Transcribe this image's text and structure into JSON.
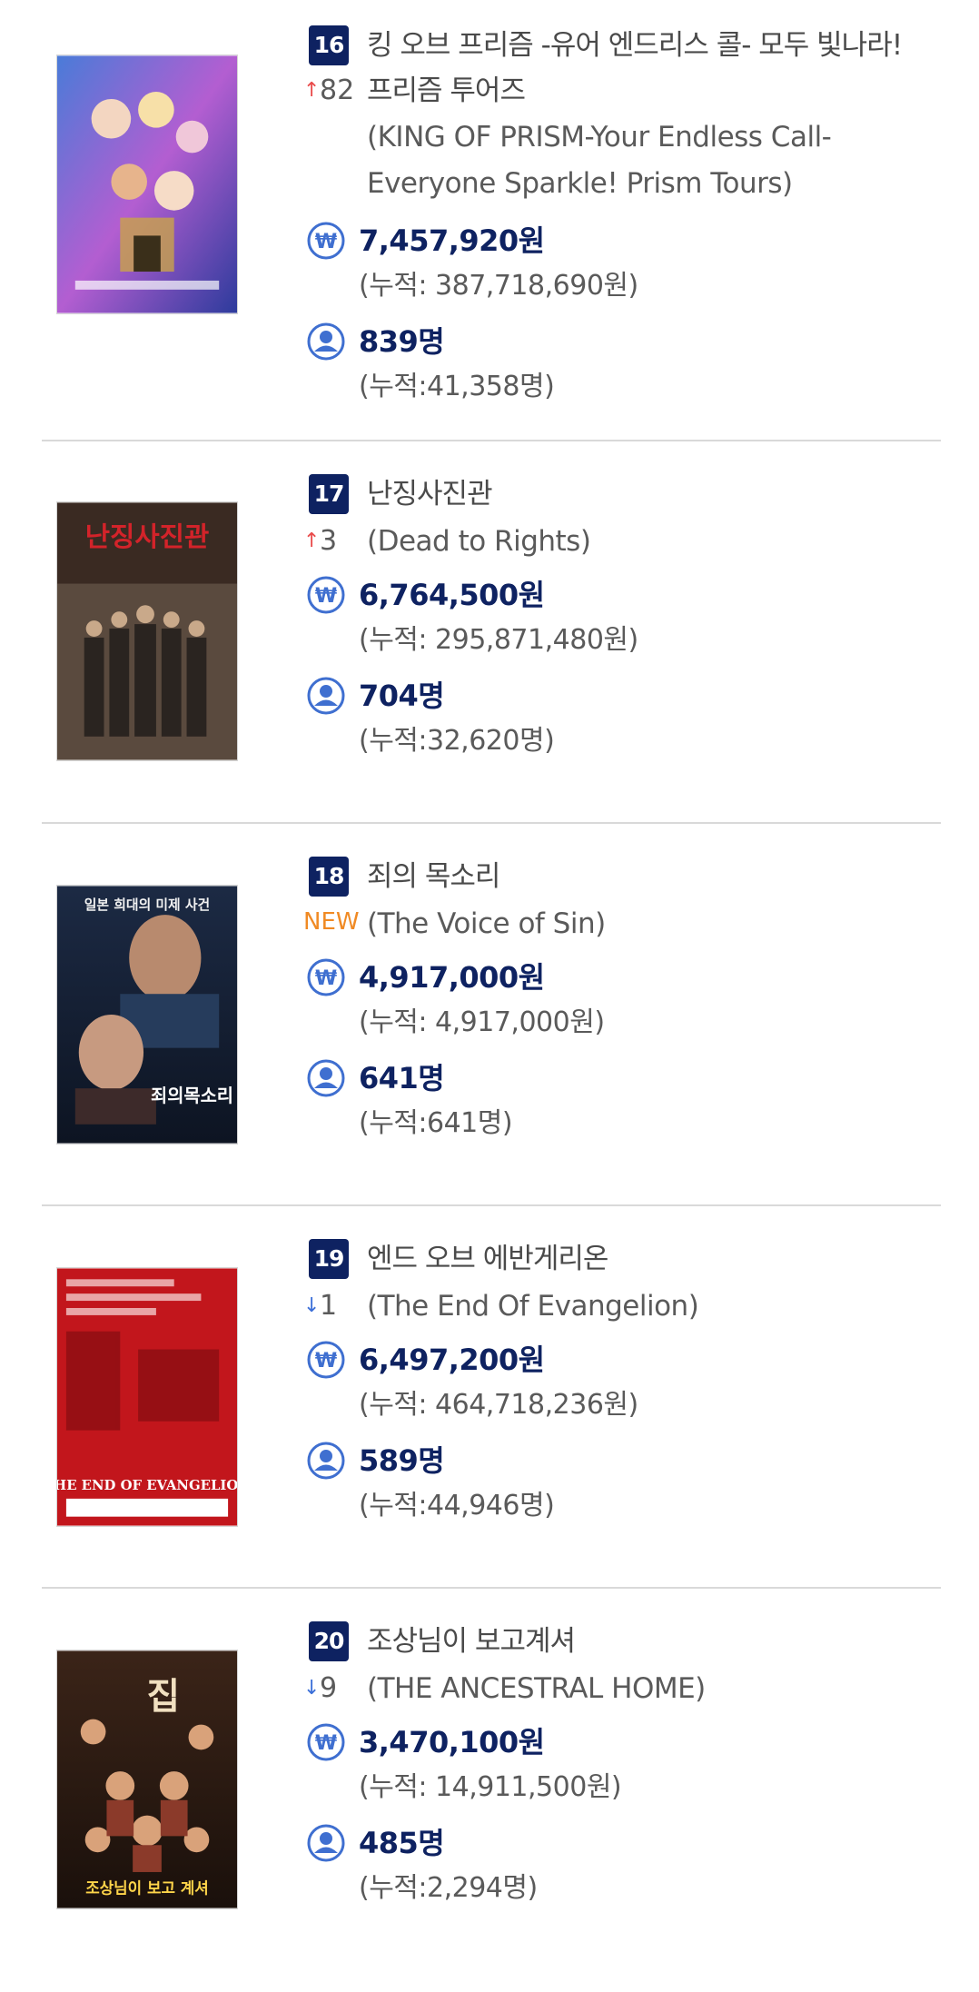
{
  "labels": {
    "cumulative_prefix": "(누적: ",
    "cumulative_suffix": ")"
  },
  "icons": {
    "revenue": "won-circle-icon",
    "audience": "person-circle-icon",
    "up": "arrow-up-icon",
    "down": "arrow-down-icon"
  },
  "colors": {
    "rank_bg": "#0e2261",
    "stat_text": "#0e2261",
    "up": "#e94b4b",
    "down": "#3b6fd8",
    "new": "#f08a24",
    "icon": "#3f6fd0"
  },
  "movies": [
    {
      "rank": "16",
      "title_ko": "킹 오브 프리즘 -유어 엔드리스 콜- 모두 빛나라!",
      "title_ko_cont": "프리즘 투어즈",
      "change": "82",
      "change_dir": "up",
      "title_en_lines": [
        "(KING OF PRISM-Your Endless Call-",
        "Everyone Sparkle! Prism Tours)"
      ],
      "revenue": "7,457,920원",
      "revenue_cum": "(누적: 387,718,690원)",
      "audience": "839명",
      "audience_cum": "(누적:41,358명)"
    },
    {
      "rank": "17",
      "title_ko": "난징사진관",
      "change": "3",
      "change_dir": "up",
      "title_en": "(Dead to Rights)",
      "revenue": "6,764,500원",
      "revenue_cum": "(누적: 295,871,480원)",
      "audience": "704명",
      "audience_cum": "(누적:32,620명)"
    },
    {
      "rank": "18",
      "title_ko": "죄의 목소리",
      "change": "NEW",
      "change_dir": "new",
      "title_en": "(The Voice of Sin)",
      "revenue": "4,917,000원",
      "revenue_cum": "(누적: 4,917,000원)",
      "audience": "641명",
      "audience_cum": "(누적:641명)"
    },
    {
      "rank": "19",
      "title_ko": "엔드 오브 에반게리온",
      "change": "1",
      "change_dir": "down",
      "title_en": "(The End Of Evangelion)",
      "revenue": "6,497,200원",
      "revenue_cum": "(누적: 464,718,236원)",
      "audience": "589명",
      "audience_cum": "(누적:44,946명)"
    },
    {
      "rank": "20",
      "title_ko": "조상님이 보고계셔",
      "change": "9",
      "change_dir": "down",
      "title_en": "(THE ANCESTRAL HOME)",
      "revenue": "3,470,100원",
      "revenue_cum": "(누적: 14,911,500원)",
      "audience": "485명",
      "audience_cum": "(누적:2,294명)"
    }
  ],
  "poster_text": {
    "p17": "난징사진관",
    "p18_top": "일본 희대의 미제 사건",
    "p18_title": "죄의목소리",
    "p19": "THE END OF EVANGELION",
    "p20_title": "조상님이 보고 계셔",
    "p20_big": "집"
  }
}
